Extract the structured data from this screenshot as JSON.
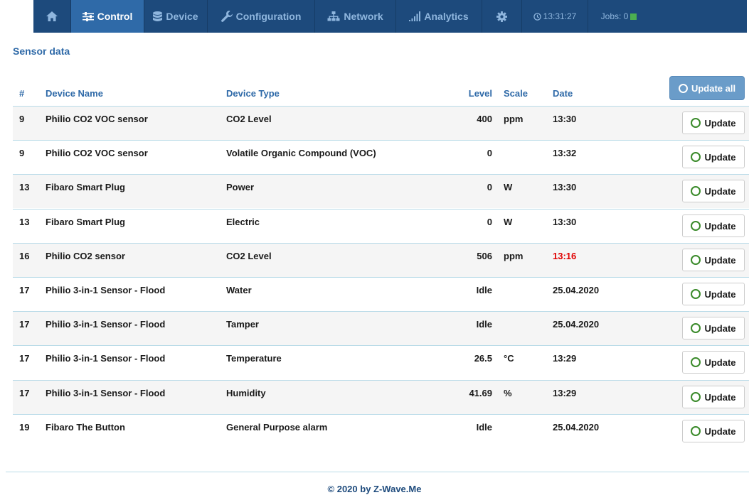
{
  "nav": {
    "items": [
      {
        "label": "",
        "icon": "home-icon"
      },
      {
        "label": "Control",
        "icon": "sliders-icon"
      },
      {
        "label": "Device",
        "icon": "database-icon"
      },
      {
        "label": "Configuration",
        "icon": "wrench-icon"
      },
      {
        "label": "Network",
        "icon": "network-icon"
      },
      {
        "label": "Analytics",
        "icon": "signal-icon"
      },
      {
        "label": "",
        "icon": "gear-icon"
      }
    ],
    "active": "Control",
    "clock": "13:31:27",
    "jobs_label": "Jobs: 0",
    "jobs_status_color": "#4caf50",
    "bar_color": "#1d4a7c",
    "active_color": "#2f6aa8"
  },
  "page": {
    "title": "Sensor data",
    "update_all_label": "Update all"
  },
  "table": {
    "headers": {
      "id": "#",
      "name": "Device Name",
      "type": "Device Type",
      "level": "Level",
      "scale": "Scale",
      "date": "Date"
    },
    "update_label": "Update",
    "rows": [
      {
        "id": "9",
        "name": "Philio CO2 VOC sensor",
        "type": "CO2 Level",
        "level": "400",
        "scale": "ppm",
        "date": "13:30",
        "stale": false
      },
      {
        "id": "9",
        "name": "Philio CO2 VOC sensor",
        "type": "Volatile Organic Compound (VOC)",
        "level": "0",
        "scale": "",
        "date": "13:32",
        "stale": false
      },
      {
        "id": "13",
        "name": "Fibaro Smart Plug",
        "type": "Power",
        "level": "0",
        "scale": "W",
        "date": "13:30",
        "stale": false
      },
      {
        "id": "13",
        "name": "Fibaro Smart Plug",
        "type": "Electric",
        "level": "0",
        "scale": "W",
        "date": "13:30",
        "stale": false
      },
      {
        "id": "16",
        "name": "Philio CO2 sensor",
        "type": "CO2 Level",
        "level": "506",
        "scale": "ppm",
        "date": "13:16",
        "stale": true
      },
      {
        "id": "17",
        "name": "Philio 3-in-1 Sensor - Flood",
        "type": "Water",
        "level": "Idle",
        "scale": "",
        "date": "25.04.2020",
        "stale": false
      },
      {
        "id": "17",
        "name": "Philio 3-in-1 Sensor - Flood",
        "type": "Tamper",
        "level": "Idle",
        "scale": "",
        "date": "25.04.2020",
        "stale": false
      },
      {
        "id": "17",
        "name": "Philio 3-in-1 Sensor - Flood",
        "type": "Temperature",
        "level": "26.5",
        "scale": "°C",
        "date": "13:29",
        "stale": false
      },
      {
        "id": "17",
        "name": "Philio 3-in-1 Sensor - Flood",
        "type": "Humidity",
        "level": "41.69",
        "scale": "%",
        "date": "13:29",
        "stale": false
      },
      {
        "id": "19",
        "name": "Fibaro The Button",
        "type": "General Purpose alarm",
        "level": "Idle",
        "scale": "",
        "date": "25.04.2020",
        "stale": false
      }
    ]
  },
  "footer": {
    "text": "© 2020 by Z-Wave.Me"
  }
}
